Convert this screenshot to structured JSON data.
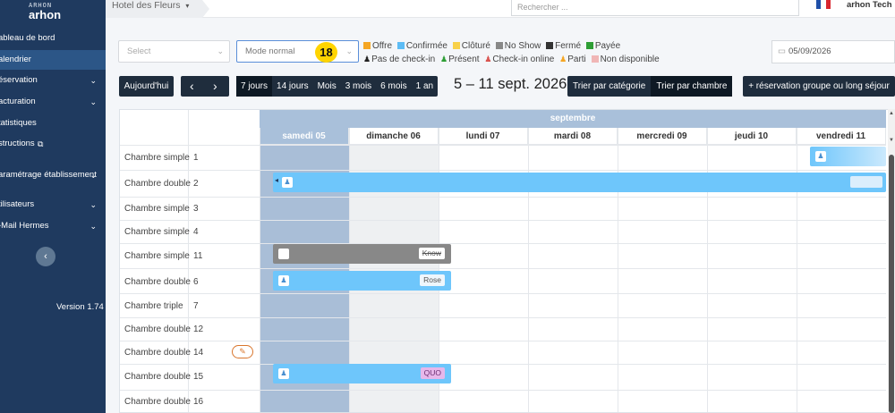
{
  "app": {
    "logo_mark": "ARHON",
    "logo_text": "arhon"
  },
  "topbar": {
    "hotel": "Hotel des Fleurs",
    "search_placeholder": "Rechercher ...",
    "user": "arhon Tech"
  },
  "sidebar": {
    "items": [
      {
        "label": "ableau de bord",
        "chevron": false
      },
      {
        "label": "alendrier",
        "chevron": false,
        "active": true
      },
      {
        "label": "éservation",
        "chevron": true
      },
      {
        "label": "acturation",
        "chevron": true
      },
      {
        "label": "tatistiques",
        "chevron": false
      },
      {
        "label": "structions",
        "chevron": false,
        "external": true
      },
      {
        "label": "aramétrage établissement",
        "chevron": true
      },
      {
        "label": "tilisateurs",
        "chevron": true
      },
      {
        "label": "-Mail Hermes",
        "chevron": true
      }
    ],
    "collapse_icon": "‹",
    "version": "Version 1.74"
  },
  "filters": {
    "select_placeholder": "Select",
    "mode": "Mode normal",
    "badge": "18",
    "date": "05/09/2026"
  },
  "legend": {
    "status": [
      {
        "label": "Offre",
        "color": "#f5a623"
      },
      {
        "label": "Confirmée",
        "color": "#5dbcf5"
      },
      {
        "label": "Clôturé",
        "color": "#f8d14a"
      },
      {
        "label": "No Show",
        "color": "#888888"
      },
      {
        "label": "Fermé",
        "color": "#333333"
      },
      {
        "label": "Payée",
        "color": "#2e9e35"
      }
    ],
    "presence": [
      {
        "label": "Pas de check-in",
        "color": "#222222"
      },
      {
        "label": "Présent",
        "color": "#2e9e35"
      },
      {
        "label": "Check-in online",
        "color": "#d9534f"
      },
      {
        "label": "Parti",
        "color": "#f5a623"
      },
      {
        "label": "Non disponible",
        "color": "#f0b6b6",
        "swatch": true
      }
    ]
  },
  "nav": {
    "today": "Aujourd'hui",
    "prev": "‹",
    "next": "›",
    "periods": [
      "7 jours",
      "14 jours",
      "Mois",
      "3 mois",
      "6 mois",
      "1 an"
    ],
    "range": "5 – 11 sept. 2026",
    "sort_category": "Trier par catégorie",
    "sort_room": "Trier par chambre",
    "group_booking": "+ réservation groupe ou long séjour"
  },
  "planning": {
    "month": "septembre",
    "days": [
      "samedi 05",
      "dimanche 06",
      "lundi 07",
      "mardi 08",
      "mercredi 09",
      "jeudi 10",
      "vendredi 11"
    ],
    "rooms": [
      {
        "type": "Chambre simple",
        "num": "1"
      },
      {
        "type": "Chambre double",
        "num": "2"
      },
      {
        "type": "Chambre simple",
        "num": "3"
      },
      {
        "type": "Chambre simple",
        "num": "4"
      },
      {
        "type": "Chambre simple",
        "num": "11"
      },
      {
        "type": "Chambre double",
        "num": "6"
      },
      {
        "type": "Chambre triple",
        "num": "7"
      },
      {
        "type": "Chambre double",
        "num": "12"
      },
      {
        "type": "Chambre double",
        "num": "14"
      },
      {
        "type": "Chambre double",
        "num": "15"
      },
      {
        "type": "Chambre double",
        "num": "16"
      }
    ],
    "reservations": {
      "r1_tag": "",
      "r11_tag": "Know",
      "r6_tag": "Rose",
      "r15_tag": "QUO"
    }
  }
}
